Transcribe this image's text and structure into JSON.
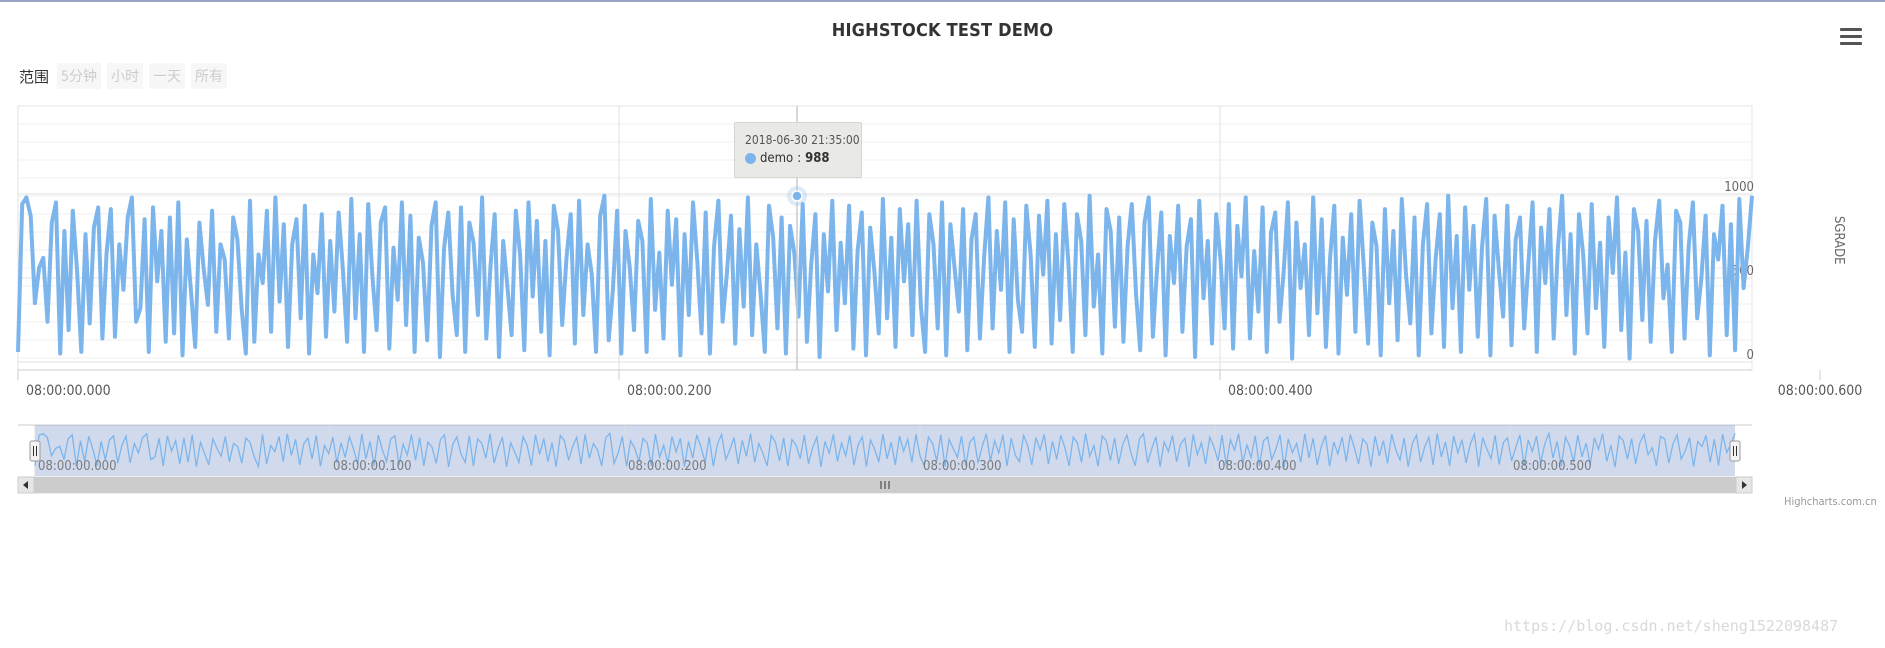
{
  "chart_data": {
    "type": "line",
    "title": "HIGHSTOCK TEST DEMO",
    "ylabel": "SGRADE",
    "ylim": [
      0,
      1000
    ],
    "y_ticks": [
      "0",
      "500",
      "1000"
    ],
    "x_ticks": [
      "08:00:00.000",
      "08:00:00.200",
      "08:00:00.400",
      "08:00:00.600"
    ],
    "navigator_ticks": [
      "08:00:00.000",
      "08:00:00.100",
      "08:00:00.200",
      "08:00:00.300",
      "08:00:00.400",
      "08:00:00.500"
    ],
    "grid": true,
    "series": [
      {
        "name": "demo",
        "color": "#7cb5ec",
        "values": [
          60,
          940,
          980,
          870,
          350,
          560,
          620,
          240,
          830,
          950,
          50,
          780,
          190,
          900,
          540,
          60,
          760,
          230,
          800,
          920,
          140,
          650,
          910,
          150,
          700,
          430,
          860,
          980,
          240,
          320,
          850,
          60,
          920,
          480,
          780,
          120,
          860,
          170,
          950,
          40,
          730,
          420,
          90,
          830,
          560,
          340,
          900,
          180,
          700,
          610,
          140,
          860,
          730,
          320,
          50,
          960,
          120,
          640,
          470,
          900,
          180,
          980,
          360,
          820,
          90,
          700,
          850,
          260,
          930,
          50,
          640,
          410,
          880,
          150,
          720,
          300,
          890,
          550,
          120,
          970,
          260,
          760,
          60,
          940,
          510,
          190,
          830,
          920,
          80,
          680,
          370,
          950,
          220,
          870,
          60,
          740,
          590,
          130,
          810,
          950,
          30,
          680,
          890,
          400,
          160,
          920,
          60,
          830,
          710,
          280,
          980,
          140,
          570,
          880,
          30,
          720,
          450,
          160,
          900,
          640,
          70,
          950,
          390,
          840,
          180,
          720,
          40,
          930,
          780,
          220,
          620,
          880,
          110,
          960,
          280,
          700,
          520,
          60,
          870,
          990,
          130,
          430,
          900,
          50,
          780,
          560,
          190,
          840,
          720,
          60,
          970,
          310,
          650,
          140,
          900,
          460,
          850,
          40,
          760,
          280,
          950,
          600,
          170,
          890,
          50,
          690,
          960,
          240,
          520,
          870,
          110,
          790,
          330,
          980,
          160,
          700,
          410,
          60,
          930,
          740,
          200,
          860,
          50,
          810,
          650,
          270,
          940,
          120,
          580,
          880,
          30,
          760,
          420,
          960,
          190,
          710,
          350,
          930,
          80,
          660,
          890,
          40,
          800,
          530,
          170,
          970,
          260,
          740,
          90,
          910,
          480,
          820,
          160,
          960,
          330,
          60,
          880,
          700,
          200,
          950,
          40,
          820,
          560,
          300,
          910,
          70,
          730,
          880,
          140,
          620,
          980,
          200,
          780,
          430,
          950,
          60,
          850,
          370,
          180,
          930,
          640,
          90,
          870,
          520,
          960,
          110,
          760,
          250,
          940,
          580,
          60,
          880,
          720,
          160,
          990,
          330,
          640,
          50,
          910,
          780,
          210,
          860,
          120,
          690,
          940,
          410,
          70,
          830,
          980,
          150,
          560,
          890,
          40,
          750,
          470,
          930,
          180,
          690,
          850,
          30,
          960,
          380,
          720,
          110,
          880,
          620,
          200,
          940,
          80,
          810,
          510,
          980,
          140,
          660,
          300,
          920,
          60,
          770,
          890,
          240,
          540,
          950,
          20,
          830,
          440,
          700,
          160,
          980,
          290,
          850,
          90,
          620,
          930,
          50,
          740,
          400,
          880,
          180,
          960,
          560,
          110,
          830,
          690,
          40,
          910,
          350,
          780,
          130,
          970,
          520,
          230,
          860,
          40,
          700,
          940,
          170,
          610,
          880,
          90,
          990,
          320,
          750,
          60,
          920,
          430,
          810,
          150,
          680,
          970,
          40,
          870,
          550,
          270,
          930,
          100,
          730,
          860,
          200,
          590,
          950,
          60,
          800,
          470,
          910,
          140,
          680,
          990,
          280,
          760,
          50,
          880,
          640,
          170,
          940,
          320,
          710,
          90,
          860,
          530,
          980,
          190,
          650,
          20,
          910,
          780,
          250,
          840,
          120,
          720,
          960,
          380,
          580,
          60,
          900,
          830,
          140,
          690,
          950,
          260,
          500,
          870,
          40,
          760,
          610,
          930,
          160,
          820,
          70,
          970,
          440,
          680,
          990
        ]
      }
    ]
  },
  "tooltip": {
    "date": "2018-06-30 21:35:00",
    "series": "demo",
    "value": "988"
  },
  "range_selector": {
    "label": "范围",
    "buttons": [
      "5分钟",
      "小时",
      "一天",
      "所有"
    ]
  },
  "credits": "Highcharts.com.cn",
  "watermark": "https://blog.csdn.net/sheng1522098487"
}
